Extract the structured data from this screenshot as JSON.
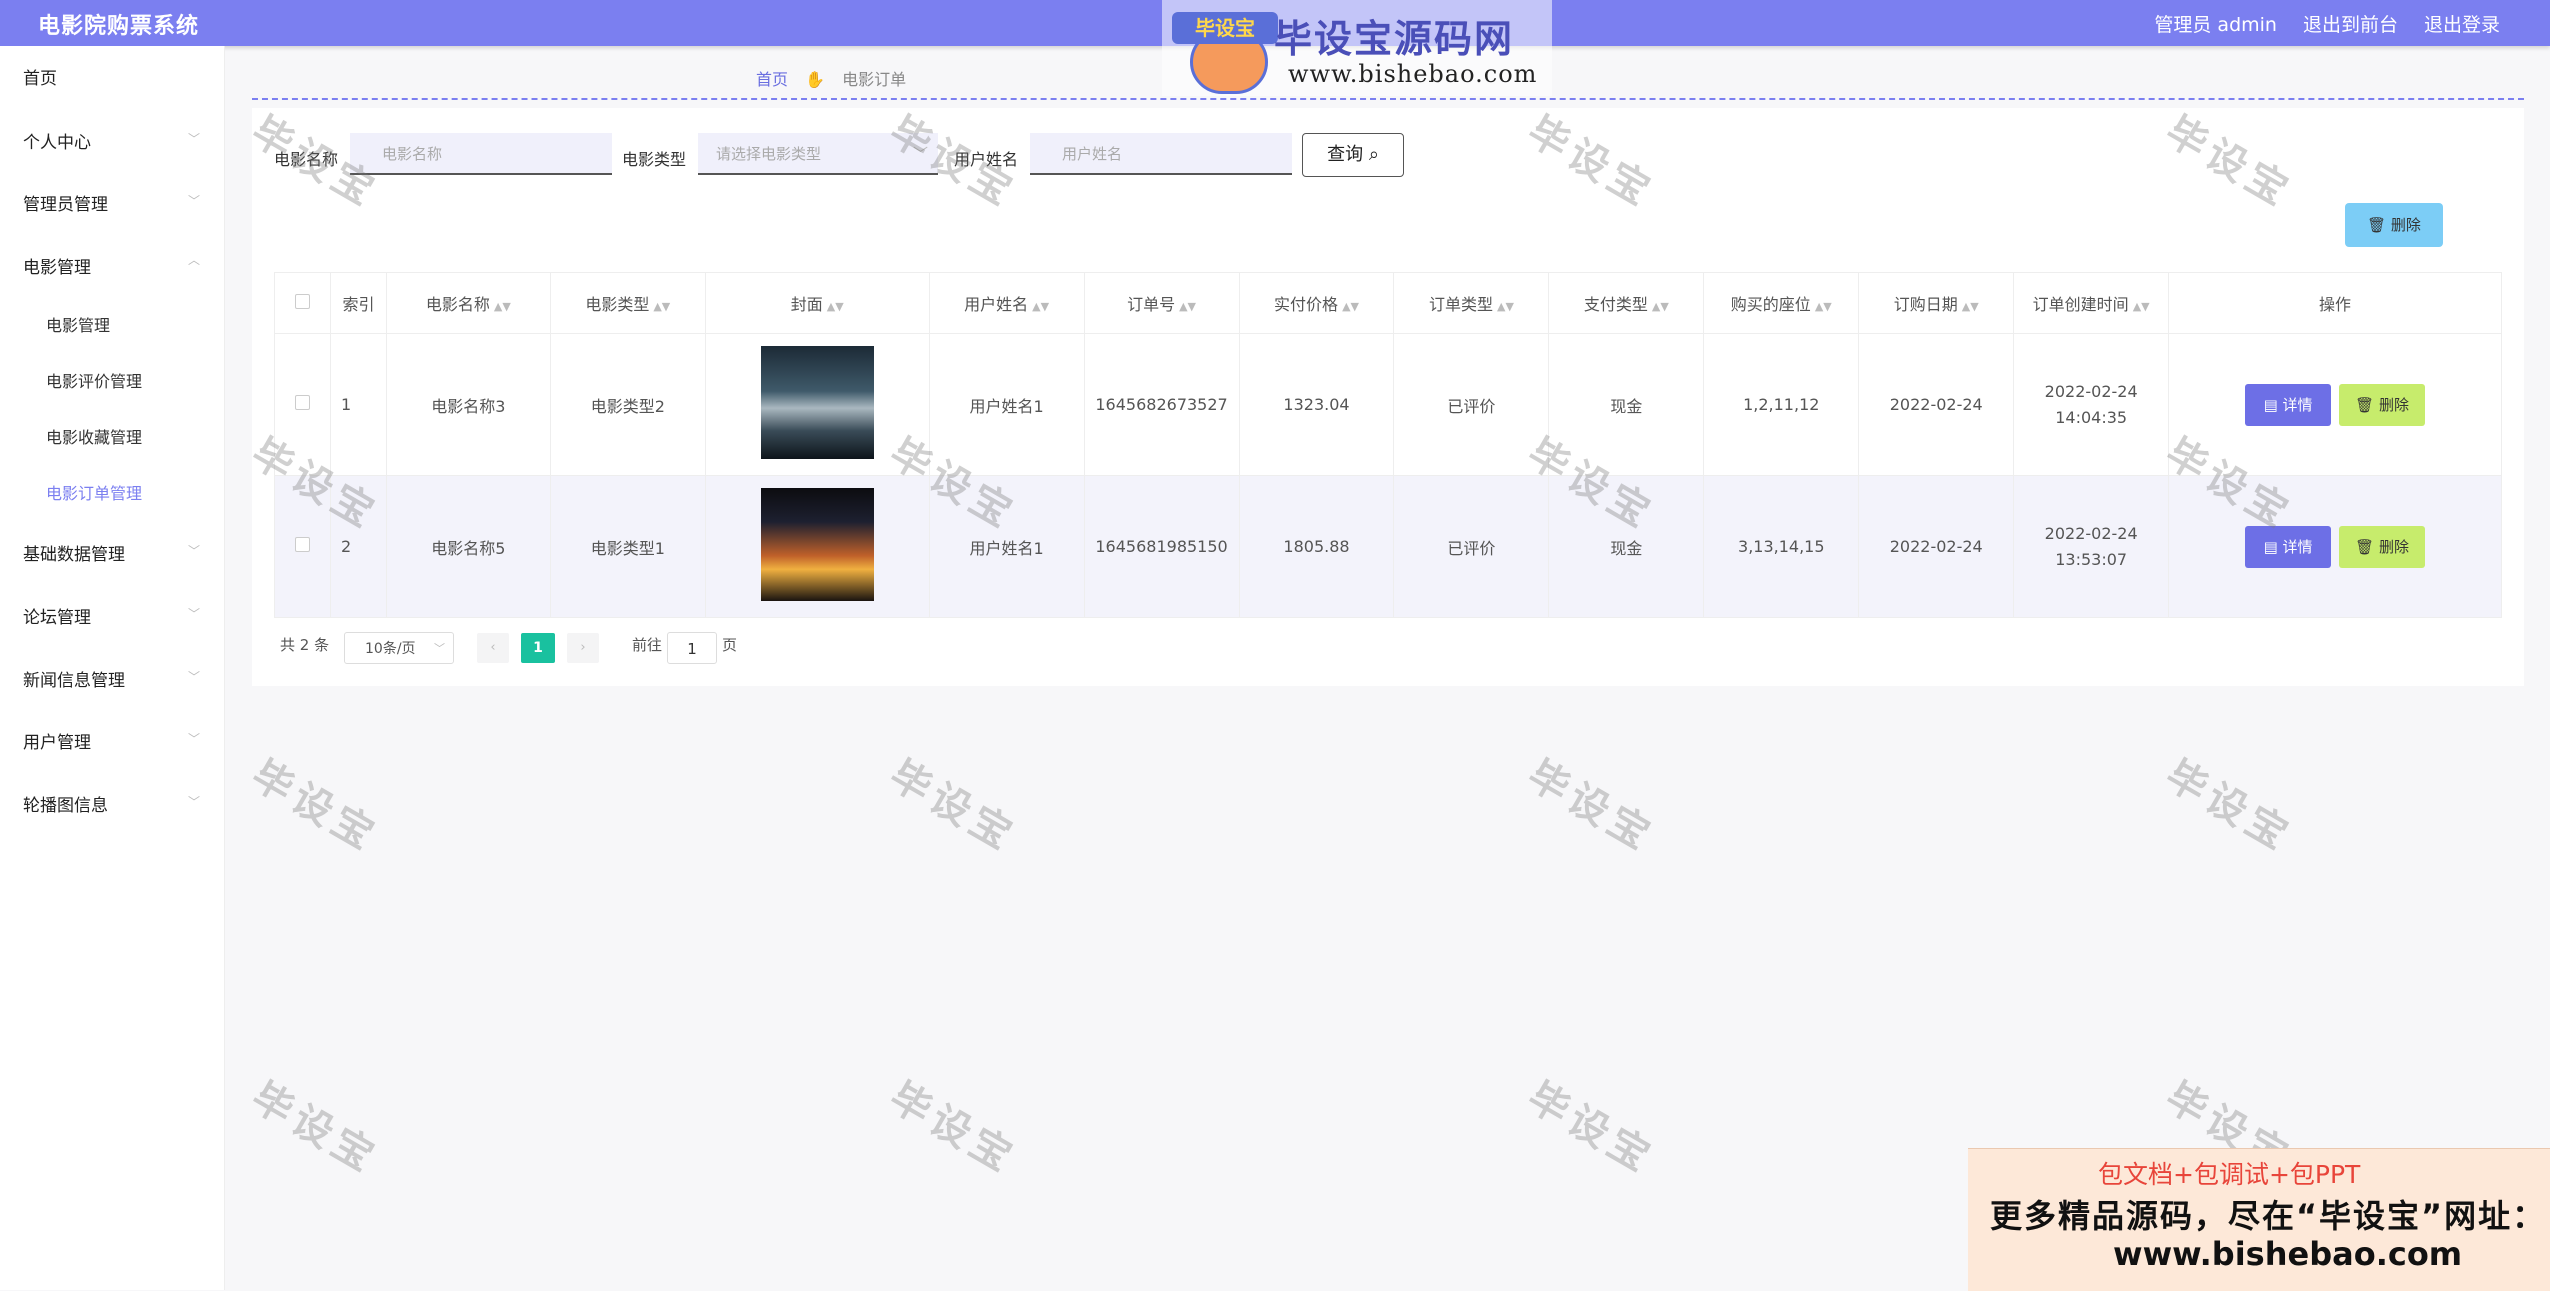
{
  "app": {
    "title": "电影院购票系统",
    "nav": [
      "管理员 admin",
      "退出到前台",
      "退出登录"
    ]
  },
  "logo": {
    "badge": "毕设宝",
    "name": "毕设宝源码网",
    "url": "www.bishebao.com"
  },
  "sidebar": {
    "items": [
      {
        "label": "首页"
      },
      {
        "label": "个人中心"
      },
      {
        "label": "管理员管理"
      },
      {
        "label": "电影管理"
      },
      {
        "label": "电影管理"
      },
      {
        "label": "电影评价管理"
      },
      {
        "label": "电影收藏管理"
      },
      {
        "label": "电影订单管理"
      },
      {
        "label": "基础数据管理"
      },
      {
        "label": "论坛管理"
      },
      {
        "label": "新闻信息管理"
      },
      {
        "label": "用户管理"
      },
      {
        "label": "轮播图信息"
      }
    ]
  },
  "breadcrumb": {
    "home": "首页",
    "current": "电影订单"
  },
  "search": {
    "name_label": "电影名称",
    "name_placeholder": "电影名称",
    "type_label": "电影类型",
    "type_placeholder": "请选择电影类型",
    "user_label": "用户姓名",
    "user_placeholder": "用户姓名",
    "query_button": "查询"
  },
  "toolbar": {
    "delete_label": "删除"
  },
  "table": {
    "headers": [
      "索引",
      "电影名称",
      "电影类型",
      "封面",
      "用户姓名",
      "订单号",
      "实付价格",
      "订单类型",
      "支付类型",
      "购买的座位",
      "订购日期",
      "订单创建时间",
      "操作"
    ],
    "rows": [
      {
        "index": "1",
        "movie": "电影名称3",
        "type": "电影类型2",
        "user": "用户姓名1",
        "order_no": "1645682673527",
        "price": "1323.04",
        "order_type": "已评价",
        "pay_type": "现金",
        "seats": "1,2,11,12",
        "date": "2022-02-24",
        "created": "2022-02-24 14:04:35"
      },
      {
        "index": "2",
        "movie": "电影名称5",
        "type": "电影类型1",
        "user": "用户姓名1",
        "order_no": "1645681985150",
        "price": "1805.88",
        "order_type": "已评价",
        "pay_type": "现金",
        "seats": "3,13,14,15",
        "date": "2022-02-24",
        "created": "2022-02-24 13:53:07"
      }
    ],
    "detail_label": "详情",
    "delete_label": "删除"
  },
  "pagination": {
    "total": "共 2 条",
    "page_size": "10条/页",
    "current": "1",
    "goto_label": "前往",
    "goto_value": "1",
    "page_suffix": "页"
  },
  "watermark": "毕设宝",
  "ad": {
    "line1": "包文档+包调试+包PPT",
    "line2": "更多精品源码，尽在“毕设宝”网址：",
    "line3": "www.bishebao.com"
  },
  "colors": {
    "accent": "#7b7ff0",
    "detail": "#6d6fe6",
    "delete": "#c7ec6c",
    "page_current": "#19c19f"
  }
}
